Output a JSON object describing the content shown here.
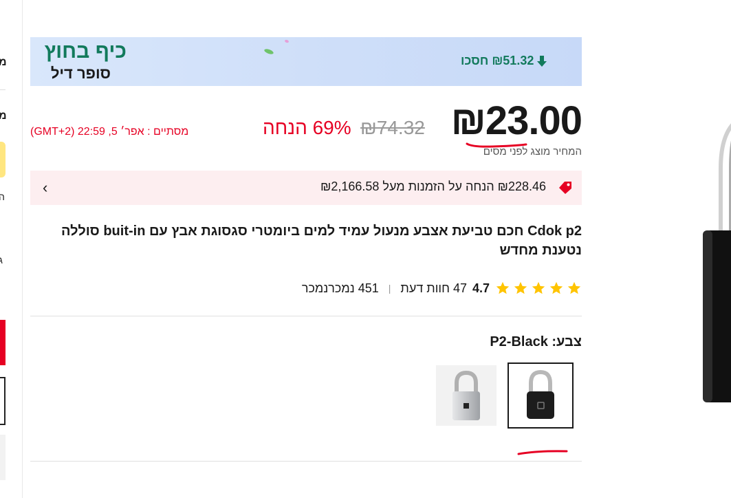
{
  "sidebar": {
    "chars": [
      "מ",
      "מ",
      "ה",
      "ג"
    ]
  },
  "banner": {
    "title": "כיף בחוץ",
    "subtitle": "סופר דיל",
    "savings": "₪51.32 חסכו"
  },
  "price": {
    "current": "₪23.00",
    "original": "₪74.32",
    "discount": "69% הנחה",
    "ends": "מסתיים :  אפר׳ 5, 22:59 (GMT+2)",
    "tax_note": "המחיר מוצג לפני מסים"
  },
  "coupon": {
    "text": "₪228.46 הנחה על הזמנות מעל ₪2,166.58"
  },
  "product": {
    "title": "Cdok p2 חכם טביעת אצבע מנעול עמיד למים ביומטרי סגסוגת אבץ עם buit-in סוללה נטענת מחדש",
    "rating": "4.7",
    "reviews": "47 חוות דעת",
    "sold": "451 נמכרנמכר"
  },
  "color": {
    "label": "צבע: P2-Black",
    "options": [
      "P2-Black",
      "P2-Silver"
    ]
  },
  "colors": {
    "accent_red": "#e60023",
    "deal_green": "#127a5c",
    "star": "#ffc400"
  }
}
